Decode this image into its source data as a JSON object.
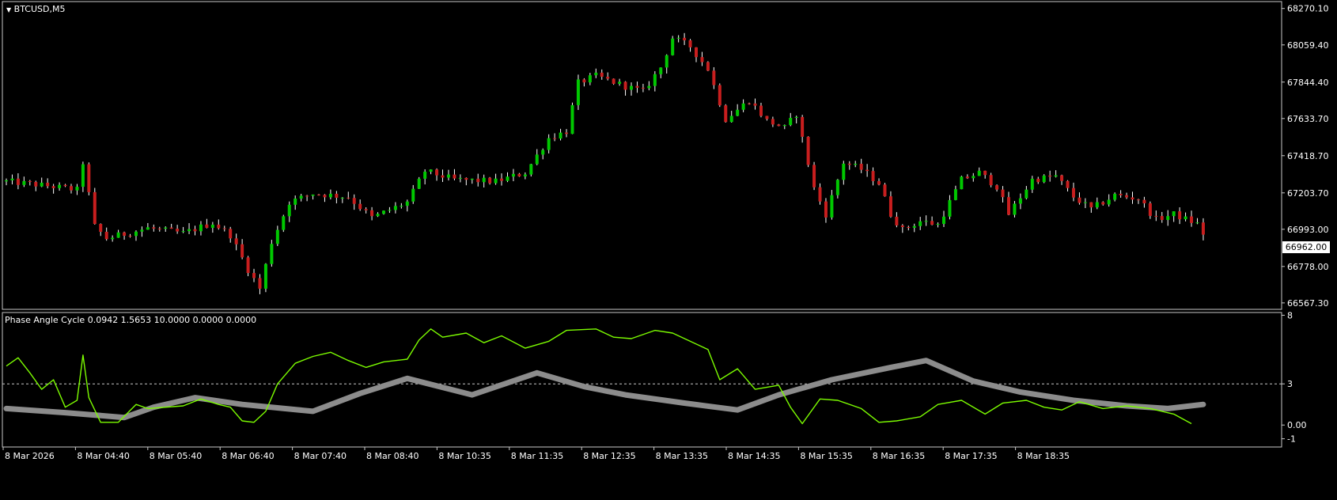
{
  "main_panel": {
    "title": "BTCUSD,M5",
    "current_price_label": "66962.00"
  },
  "indicator_panel": {
    "title": "Phase Angle Cycle 0.0942 1.5653 10.0000 0.0000 0.0000"
  },
  "colors": {
    "background": "#000000",
    "frame": "#c8c8c8",
    "bull_candle": "#00c800",
    "bear_candle": "#c81e1e",
    "wick": "#ffffff",
    "phase_line": "#7cfc00",
    "cycle_line": "#8c8c8c",
    "level_line": "#c8c8c8",
    "text": "#ffffff"
  },
  "chart_data": [
    {
      "type": "candlestick",
      "title": "BTCUSD,M5",
      "y_axis_labels": [
        "68270.10",
        "68059.40",
        "67844.40",
        "67633.70",
        "67418.70",
        "67203.70",
        "66993.00",
        "66778.00",
        "66567.30"
      ],
      "ylim": [
        66530,
        68310
      ],
      "x_axis_labels": [
        "8 Mar 2026",
        "8 Mar 04:40",
        "8 Mar 05:40",
        "8 Mar 06:40",
        "8 Mar 07:40",
        "8 Mar 08:40",
        "8 Mar 10:35",
        "8 Mar 11:35",
        "8 Mar 12:35",
        "8 Mar 13:35",
        "8 Mar 14:35",
        "8 Mar 15:35",
        "8 Mar 16:35",
        "8 Mar 17:35",
        "8 Mar 18:35"
      ],
      "candle_index_range": [
        0,
        223
      ],
      "close_path": [
        {
          "i": 0,
          "c": 67270
        },
        {
          "i": 8,
          "c": 67240
        },
        {
          "i": 12,
          "c": 67220
        },
        {
          "i": 13,
          "c": 67380
        },
        {
          "i": 15,
          "c": 67010
        },
        {
          "i": 17,
          "c": 66940
        },
        {
          "i": 24,
          "c": 67000
        },
        {
          "i": 30,
          "c": 66970
        },
        {
          "i": 35,
          "c": 67030
        },
        {
          "i": 38,
          "c": 66960
        },
        {
          "i": 41,
          "c": 66760
        },
        {
          "i": 43,
          "c": 66650
        },
        {
          "i": 45,
          "c": 66920
        },
        {
          "i": 48,
          "c": 67150
        },
        {
          "i": 52,
          "c": 67200
        },
        {
          "i": 58,
          "c": 67180
        },
        {
          "i": 62,
          "c": 67060
        },
        {
          "i": 68,
          "c": 67150
        },
        {
          "i": 71,
          "c": 67330
        },
        {
          "i": 76,
          "c": 67280
        },
        {
          "i": 83,
          "c": 67270
        },
        {
          "i": 88,
          "c": 67320
        },
        {
          "i": 92,
          "c": 67520
        },
        {
          "i": 95,
          "c": 67560
        },
        {
          "i": 97,
          "c": 67840
        },
        {
          "i": 100,
          "c": 67880
        },
        {
          "i": 105,
          "c": 67820
        },
        {
          "i": 108,
          "c": 67790
        },
        {
          "i": 111,
          "c": 67930
        },
        {
          "i": 113,
          "c": 68100
        },
        {
          "i": 116,
          "c": 68050
        },
        {
          "i": 119,
          "c": 67920
        },
        {
          "i": 122,
          "c": 67630
        },
        {
          "i": 126,
          "c": 67740
        },
        {
          "i": 129,
          "c": 67620
        },
        {
          "i": 132,
          "c": 67580
        },
        {
          "i": 134,
          "c": 67660
        },
        {
          "i": 137,
          "c": 67230
        },
        {
          "i": 139,
          "c": 67080
        },
        {
          "i": 142,
          "c": 67380
        },
        {
          "i": 145,
          "c": 67340
        },
        {
          "i": 148,
          "c": 67260
        },
        {
          "i": 150,
          "c": 67080
        },
        {
          "i": 152,
          "c": 66990
        },
        {
          "i": 155,
          "c": 67040
        },
        {
          "i": 158,
          "c": 67020
        },
        {
          "i": 160,
          "c": 67150
        },
        {
          "i": 162,
          "c": 67280
        },
        {
          "i": 165,
          "c": 67320
        },
        {
          "i": 168,
          "c": 67240
        },
        {
          "i": 170,
          "c": 67080
        },
        {
          "i": 174,
          "c": 67280
        },
        {
          "i": 178,
          "c": 67300
        },
        {
          "i": 181,
          "c": 67180
        },
        {
          "i": 184,
          "c": 67110
        },
        {
          "i": 188,
          "c": 67190
        },
        {
          "i": 192,
          "c": 67170
        },
        {
          "i": 195,
          "c": 67050
        },
        {
          "i": 198,
          "c": 67080
        },
        {
          "i": 203,
          "c": 67010
        }
      ],
      "last_close": 66962.0
    },
    {
      "type": "line",
      "title": "Phase Angle Cycle 0.0942 1.5653 10.0000 0.0000 0.0000",
      "y_axis_labels": [
        "8",
        "3",
        "0.00",
        "-1"
      ],
      "ylim": [
        -1.6,
        8.2
      ],
      "level_line": 3,
      "series": [
        {
          "values_at_candle_index": [
            {
              "i": 0,
              "v": 4.3
            },
            {
              "i": 2,
              "v": 4.9
            },
            {
              "i": 4,
              "v": 3.8
            },
            {
              "i": 6,
              "v": 2.6
            },
            {
              "i": 8,
              "v": 3.3
            },
            {
              "i": 10,
              "v": 1.3
            },
            {
              "i": 12,
              "v": 1.8
            },
            {
              "i": 13,
              "v": 5.1
            },
            {
              "i": 14,
              "v": 2.0
            },
            {
              "i": 16,
              "v": 0.2
            },
            {
              "i": 19,
              "v": 0.2
            },
            {
              "i": 22,
              "v": 1.5
            },
            {
              "i": 24,
              "v": 1.2
            },
            {
              "i": 30,
              "v": 1.4
            },
            {
              "i": 33,
              "v": 1.9
            },
            {
              "i": 36,
              "v": 1.5
            },
            {
              "i": 38,
              "v": 1.3
            },
            {
              "i": 40,
              "v": 0.3
            },
            {
              "i": 42,
              "v": 0.2
            },
            {
              "i": 44,
              "v": 1.0
            },
            {
              "i": 46,
              "v": 3.0
            },
            {
              "i": 49,
              "v": 4.5
            },
            {
              "i": 52,
              "v": 5.0
            },
            {
              "i": 55,
              "v": 5.3
            },
            {
              "i": 58,
              "v": 4.7
            },
            {
              "i": 61,
              "v": 4.2
            },
            {
              "i": 64,
              "v": 4.6
            },
            {
              "i": 68,
              "v": 4.8
            },
            {
              "i": 70,
              "v": 6.2
            },
            {
              "i": 72,
              "v": 7.0
            },
            {
              "i": 74,
              "v": 6.4
            },
            {
              "i": 78,
              "v": 6.7
            },
            {
              "i": 81,
              "v": 6.0
            },
            {
              "i": 84,
              "v": 6.5
            },
            {
              "i": 88,
              "v": 5.6
            },
            {
              "i": 92,
              "v": 6.1
            },
            {
              "i": 95,
              "v": 6.9
            },
            {
              "i": 100,
              "v": 7.0
            },
            {
              "i": 103,
              "v": 6.4
            },
            {
              "i": 106,
              "v": 6.3
            },
            {
              "i": 110,
              "v": 6.9
            },
            {
              "i": 113,
              "v": 6.7
            },
            {
              "i": 116,
              "v": 6.1
            },
            {
              "i": 119,
              "v": 5.5
            },
            {
              "i": 121,
              "v": 3.3
            },
            {
              "i": 124,
              "v": 4.1
            },
            {
              "i": 127,
              "v": 2.6
            },
            {
              "i": 131,
              "v": 2.9
            },
            {
              "i": 133,
              "v": 1.3
            },
            {
              "i": 135,
              "v": 0.1
            },
            {
              "i": 138,
              "v": 1.9
            },
            {
              "i": 141,
              "v": 1.8
            },
            {
              "i": 145,
              "v": 1.2
            },
            {
              "i": 148,
              "v": 0.2
            },
            {
              "i": 151,
              "v": 0.3
            },
            {
              "i": 155,
              "v": 0.6
            },
            {
              "i": 158,
              "v": 1.5
            },
            {
              "i": 162,
              "v": 1.8
            },
            {
              "i": 166,
              "v": 0.8
            },
            {
              "i": 169,
              "v": 1.6
            },
            {
              "i": 173,
              "v": 1.8
            },
            {
              "i": 176,
              "v": 1.3
            },
            {
              "i": 179,
              "v": 1.1
            },
            {
              "i": 182,
              "v": 1.7
            },
            {
              "i": 186,
              "v": 1.2
            },
            {
              "i": 190,
              "v": 1.4
            },
            {
              "i": 194,
              "v": 1.2
            },
            {
              "i": 198,
              "v": 0.8
            },
            {
              "i": 201,
              "v": 0.1
            }
          ]
        },
        {
          "values_at_candle_index": [
            {
              "i": 0,
              "v": 1.2
            },
            {
              "i": 10,
              "v": 0.9
            },
            {
              "i": 20,
              "v": 0.55
            },
            {
              "i": 25,
              "v": 1.3
            },
            {
              "i": 32,
              "v": 2.0
            },
            {
              "i": 40,
              "v": 1.5
            },
            {
              "i": 52,
              "v": 1.0
            },
            {
              "i": 60,
              "v": 2.3
            },
            {
              "i": 68,
              "v": 3.4
            },
            {
              "i": 79,
              "v": 2.2
            },
            {
              "i": 90,
              "v": 3.8
            },
            {
              "i": 98,
              "v": 2.8
            },
            {
              "i": 105,
              "v": 2.2
            },
            {
              "i": 115,
              "v": 1.6
            },
            {
              "i": 124,
              "v": 1.1
            },
            {
              "i": 131,
              "v": 2.2
            },
            {
              "i": 140,
              "v": 3.3
            },
            {
              "i": 150,
              "v": 4.2
            },
            {
              "i": 156,
              "v": 4.7
            },
            {
              "i": 164,
              "v": 3.2
            },
            {
              "i": 172,
              "v": 2.4
            },
            {
              "i": 181,
              "v": 1.8
            },
            {
              "i": 190,
              "v": 1.4
            },
            {
              "i": 197,
              "v": 1.2
            },
            {
              "i": 203,
              "v": 1.5
            }
          ]
        }
      ]
    }
  ]
}
